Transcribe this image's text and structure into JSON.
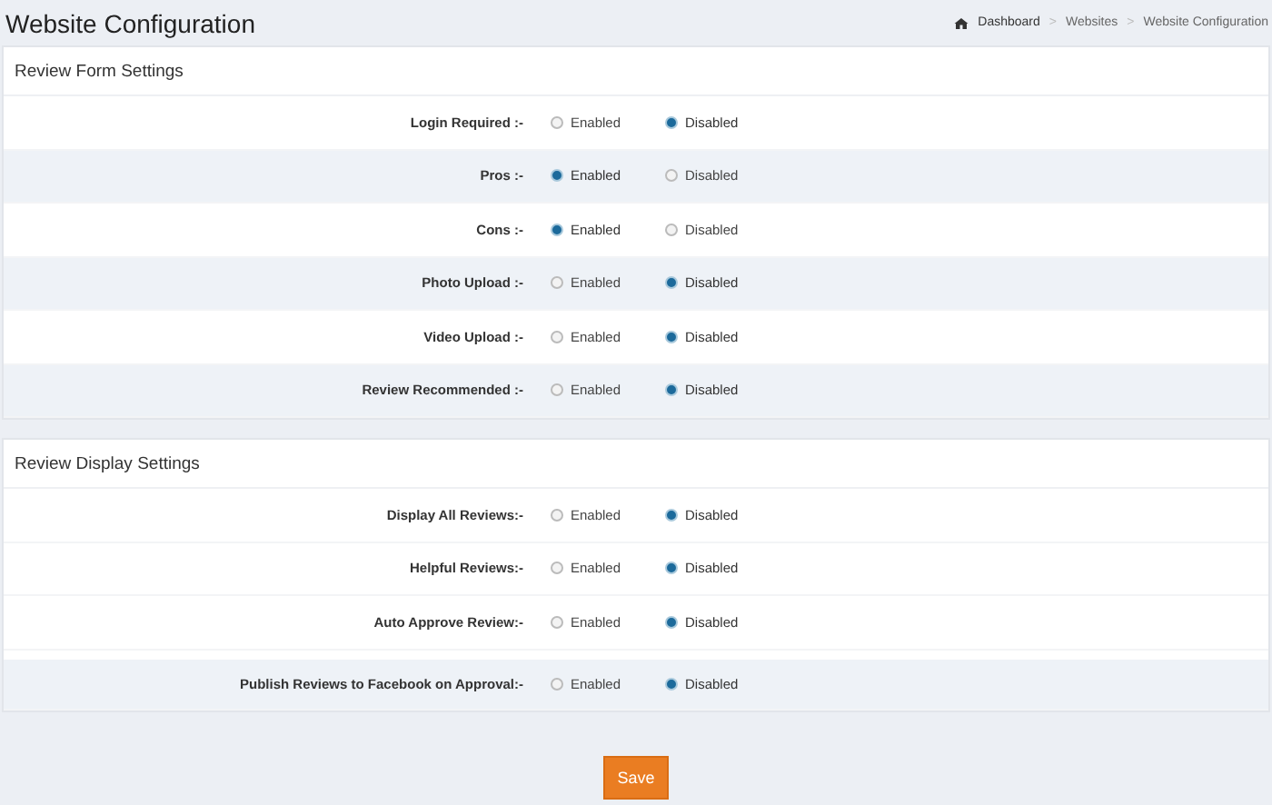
{
  "page_title": "Website Configuration",
  "breadcrumb_separator": ">",
  "breadcrumb": [
    {
      "label": "Dashboard",
      "kind": "home"
    },
    {
      "label": "Websites",
      "kind": "link"
    },
    {
      "label": "Website Configuration",
      "kind": "current"
    }
  ],
  "sections": [
    {
      "title": "Review Form Settings",
      "rows": [
        {
          "label": "Login Required :-",
          "shaded": false,
          "options": [
            {
              "label": "Enabled",
              "selected": false
            },
            {
              "label": "Disabled",
              "selected": true
            }
          ]
        },
        {
          "label": "Pros :-",
          "shaded": true,
          "options": [
            {
              "label": "Enabled",
              "selected": true
            },
            {
              "label": "Disabled",
              "selected": false
            }
          ]
        },
        {
          "label": "Cons :-",
          "shaded": false,
          "options": [
            {
              "label": "Enabled",
              "selected": true
            },
            {
              "label": "Disabled",
              "selected": false
            }
          ]
        },
        {
          "label": "Photo Upload :-",
          "shaded": true,
          "options": [
            {
              "label": "Enabled",
              "selected": false
            },
            {
              "label": "Disabled",
              "selected": true
            }
          ]
        },
        {
          "label": "Video Upload :-",
          "shaded": false,
          "options": [
            {
              "label": "Enabled",
              "selected": false
            },
            {
              "label": "Disabled",
              "selected": true
            }
          ]
        },
        {
          "label": "Review Recommended :-",
          "shaded": true,
          "options": [
            {
              "label": "Enabled",
              "selected": false
            },
            {
              "label": "Disabled",
              "selected": true
            }
          ]
        }
      ]
    },
    {
      "title": "Review Display Settings",
      "rows": [
        {
          "label": "Display All Reviews:-",
          "shaded": false,
          "options": [
            {
              "label": "Enabled",
              "selected": false
            },
            {
              "label": "Disabled",
              "selected": true
            }
          ]
        },
        {
          "label": "Helpful Reviews:-",
          "shaded": false,
          "options": [
            {
              "label": "Enabled",
              "selected": false
            },
            {
              "label": "Disabled",
              "selected": true
            }
          ]
        },
        {
          "label": "Auto Approve Review:-",
          "shaded": false,
          "options": [
            {
              "label": "Enabled",
              "selected": false
            },
            {
              "label": "Disabled",
              "selected": true
            }
          ]
        },
        {
          "label": "Publish Reviews to Facebook on Approval:-",
          "shaded": true,
          "options": [
            {
              "label": "Enabled",
              "selected": false
            },
            {
              "label": "Disabled",
              "selected": true
            }
          ]
        }
      ]
    }
  ],
  "save_button": "Save"
}
